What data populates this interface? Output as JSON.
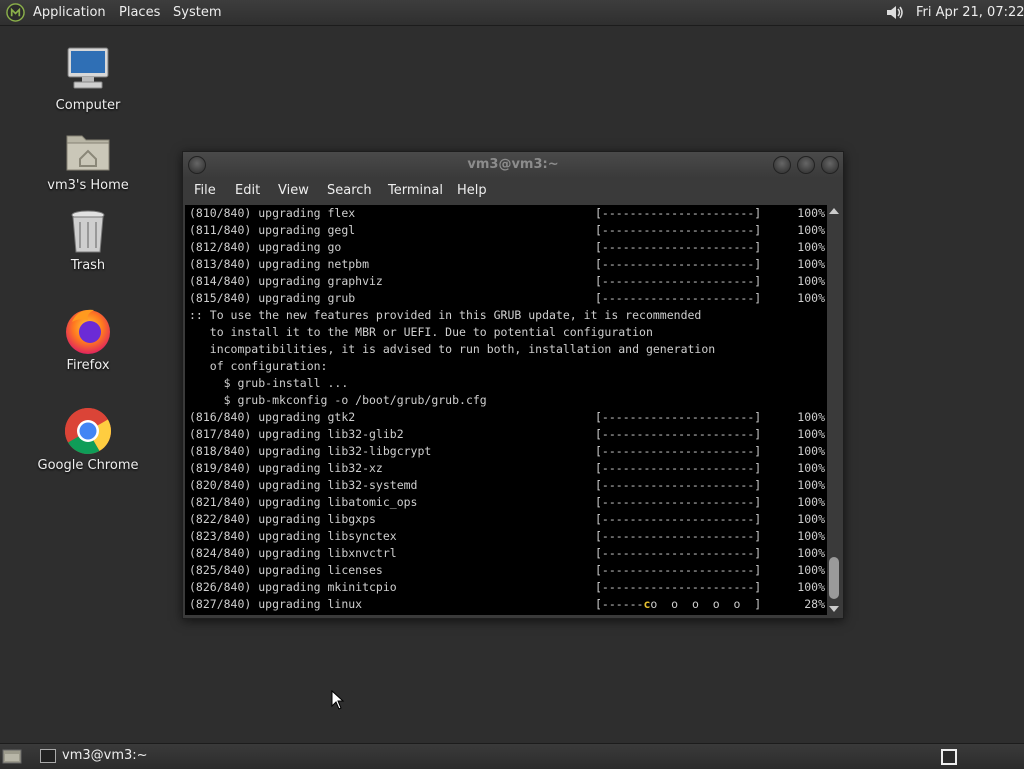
{
  "top_panel": {
    "menus": {
      "applications": "Applications",
      "places": "Places",
      "system": "System"
    },
    "clock": "Fri Apr 21, 07:22",
    "icons": {
      "logo": "mate-logo-icon",
      "volume": "volume-icon"
    }
  },
  "desktop": {
    "icons": [
      {
        "label": "Computer",
        "icon": "computer-icon"
      },
      {
        "label": "vm3's Home",
        "icon": "home-folder-icon"
      },
      {
        "label": "Trash",
        "icon": "trash-icon"
      },
      {
        "label": "Firefox",
        "icon": "firefox-icon"
      },
      {
        "label": "Google Chrome",
        "icon": "chrome-icon"
      }
    ]
  },
  "window": {
    "title": "vm3@vm3:~",
    "menu": [
      "File",
      "Edit",
      "View",
      "Search",
      "Terminal",
      "Help"
    ],
    "terminal": {
      "lines": [
        {
          "text": "(810/840) upgrading flex",
          "bar": "[----------------------]",
          "pct": "100%"
        },
        {
          "text": "(811/840) upgrading gegl",
          "bar": "[----------------------]",
          "pct": "100%"
        },
        {
          "text": "(812/840) upgrading go",
          "bar": "[----------------------]",
          "pct": "100%"
        },
        {
          "text": "(813/840) upgrading netpbm",
          "bar": "[----------------------]",
          "pct": "100%"
        },
        {
          "text": "(814/840) upgrading graphviz",
          "bar": "[----------------------]",
          "pct": "100%"
        },
        {
          "text": "(815/840) upgrading grub",
          "bar": "[----------------------]",
          "pct": "100%"
        },
        {
          "text": ":: To use the new features provided in this GRUB update, it is recommended"
        },
        {
          "text": "   to install it to the MBR or UEFI. Due to potential configuration"
        },
        {
          "text": "   incompatibilities, it is advised to run both, installation and generation"
        },
        {
          "text": "   of configuration:"
        },
        {
          "text": "     $ grub-install ..."
        },
        {
          "text": "     $ grub-mkconfig -o /boot/grub/grub.cfg"
        },
        {
          "text": "(816/840) upgrading gtk2",
          "bar": "[----------------------]",
          "pct": "100%"
        },
        {
          "text": "(817/840) upgrading lib32-glib2",
          "bar": "[----------------------]",
          "pct": "100%"
        },
        {
          "text": "(818/840) upgrading lib32-libgcrypt",
          "bar": "[----------------------]",
          "pct": "100%"
        },
        {
          "text": "(819/840) upgrading lib32-xz",
          "bar": "[----------------------]",
          "pct": "100%"
        },
        {
          "text": "(820/840) upgrading lib32-systemd",
          "bar": "[----------------------]",
          "pct": "100%"
        },
        {
          "text": "(821/840) upgrading libatomic_ops",
          "bar": "[----------------------]",
          "pct": "100%"
        },
        {
          "text": "(822/840) upgrading libgxps",
          "bar": "[----------------------]",
          "pct": "100%"
        },
        {
          "text": "(823/840) upgrading libsynctex",
          "bar": "[----------------------]",
          "pct": "100%"
        },
        {
          "text": "(824/840) upgrading libxnvctrl",
          "bar": "[----------------------]",
          "pct": "100%"
        },
        {
          "text": "(825/840) upgrading licenses",
          "bar": "[----------------------]",
          "pct": "100%"
        },
        {
          "text": "(826/840) upgrading mkinitcpio",
          "bar": "[----------------------]",
          "pct": "100%"
        },
        {
          "text": "(827/840) upgrading linux",
          "bar_left": "[------",
          "bar_pac": "c",
          "bar_right": "o  o  o  o  o  ]",
          "pct": "28%"
        }
      ]
    }
  },
  "taskbar": {
    "task_label": "vm3@vm3:~",
    "icons": {
      "show_desktop": "show-desktop-icon",
      "task": "terminal-icon",
      "workspace": "workspace-switcher-icon"
    }
  }
}
